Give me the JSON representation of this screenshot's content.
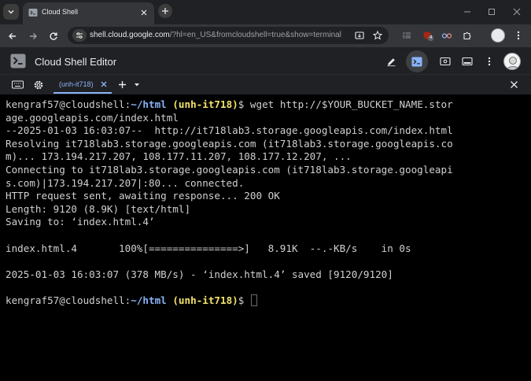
{
  "browser": {
    "tab": {
      "title": "Cloud Shell",
      "favicon": "cloud-shell-icon"
    },
    "url": {
      "host": "shell.cloud.google.com",
      "path": "/?hl=en_US&fromcloudshell=true&show=terminal"
    },
    "extension_badge": "4"
  },
  "editor": {
    "title": "Cloud Shell Editor",
    "terminal_tab": "(unh-it718)"
  },
  "terminal": {
    "lines": [
      {
        "kind": "prompt",
        "user": "kengraf57@cloudshell",
        "sep": ":",
        "path": "~/html",
        "project": "(unh-it718)",
        "dollar": "$ ",
        "cmd": "wget http://$YOUR_BUCKET_NAME.stor"
      },
      {
        "kind": "text",
        "text": "age.googleapis.com/index.html"
      },
      {
        "kind": "text",
        "text": "--2025-01-03 16:03:07--  http://it718lab3.storage.googleapis.com/index.html"
      },
      {
        "kind": "text",
        "text": "Resolving it718lab3.storage.googleapis.com (it718lab3.storage.googleapis.co"
      },
      {
        "kind": "text",
        "text": "m)... 173.194.217.207, 108.177.11.207, 108.177.12.207, ..."
      },
      {
        "kind": "text",
        "text": "Connecting to it718lab3.storage.googleapis.com (it718lab3.storage.googleapi"
      },
      {
        "kind": "text",
        "text": "s.com)|173.194.217.207|:80... connected."
      },
      {
        "kind": "text",
        "text": "HTTP request sent, awaiting response... 200 OK"
      },
      {
        "kind": "text",
        "text": "Length: 9120 (8.9K) [text/html]"
      },
      {
        "kind": "text",
        "text": "Saving to: ‘index.html.4’"
      },
      {
        "kind": "text",
        "text": ""
      },
      {
        "kind": "text",
        "text": "index.html.4       100%[===============>]   8.91K  --.-KB/s    in 0s"
      },
      {
        "kind": "text",
        "text": ""
      },
      {
        "kind": "text",
        "text": "2025-01-03 16:03:07 (378 MB/s) - ‘index.html.4’ saved [9120/9120]"
      },
      {
        "kind": "text",
        "text": ""
      },
      {
        "kind": "prompt",
        "user": "kengraf57@cloudshell",
        "sep": ":",
        "path": "~/html",
        "project": "(unh-it718)",
        "dollar": "$ ",
        "cmd": ""
      }
    ]
  },
  "colors": {
    "prompt_path": "#8ab4f8",
    "prompt_project": "#f3e36a",
    "accent": "#8ab4f8"
  }
}
